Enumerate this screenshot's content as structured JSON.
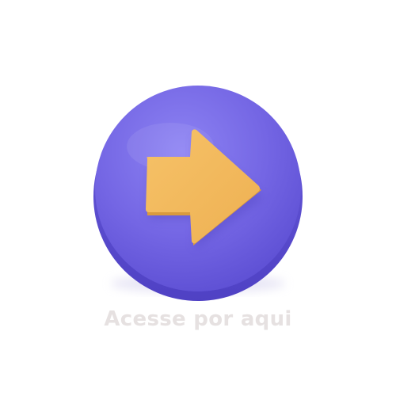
{
  "cta": {
    "label": "Acesse por aqui",
    "icon": "arrow-right-icon"
  },
  "colors": {
    "background": "#ffffff",
    "button_base": "#7466e4",
    "button_highlight": "#8a7ff0",
    "button_shadow": "#5a4bcf",
    "arrow_fill": "#f2b85a",
    "arrow_shade": "#d99a3f",
    "label": "#e6e1e1"
  }
}
